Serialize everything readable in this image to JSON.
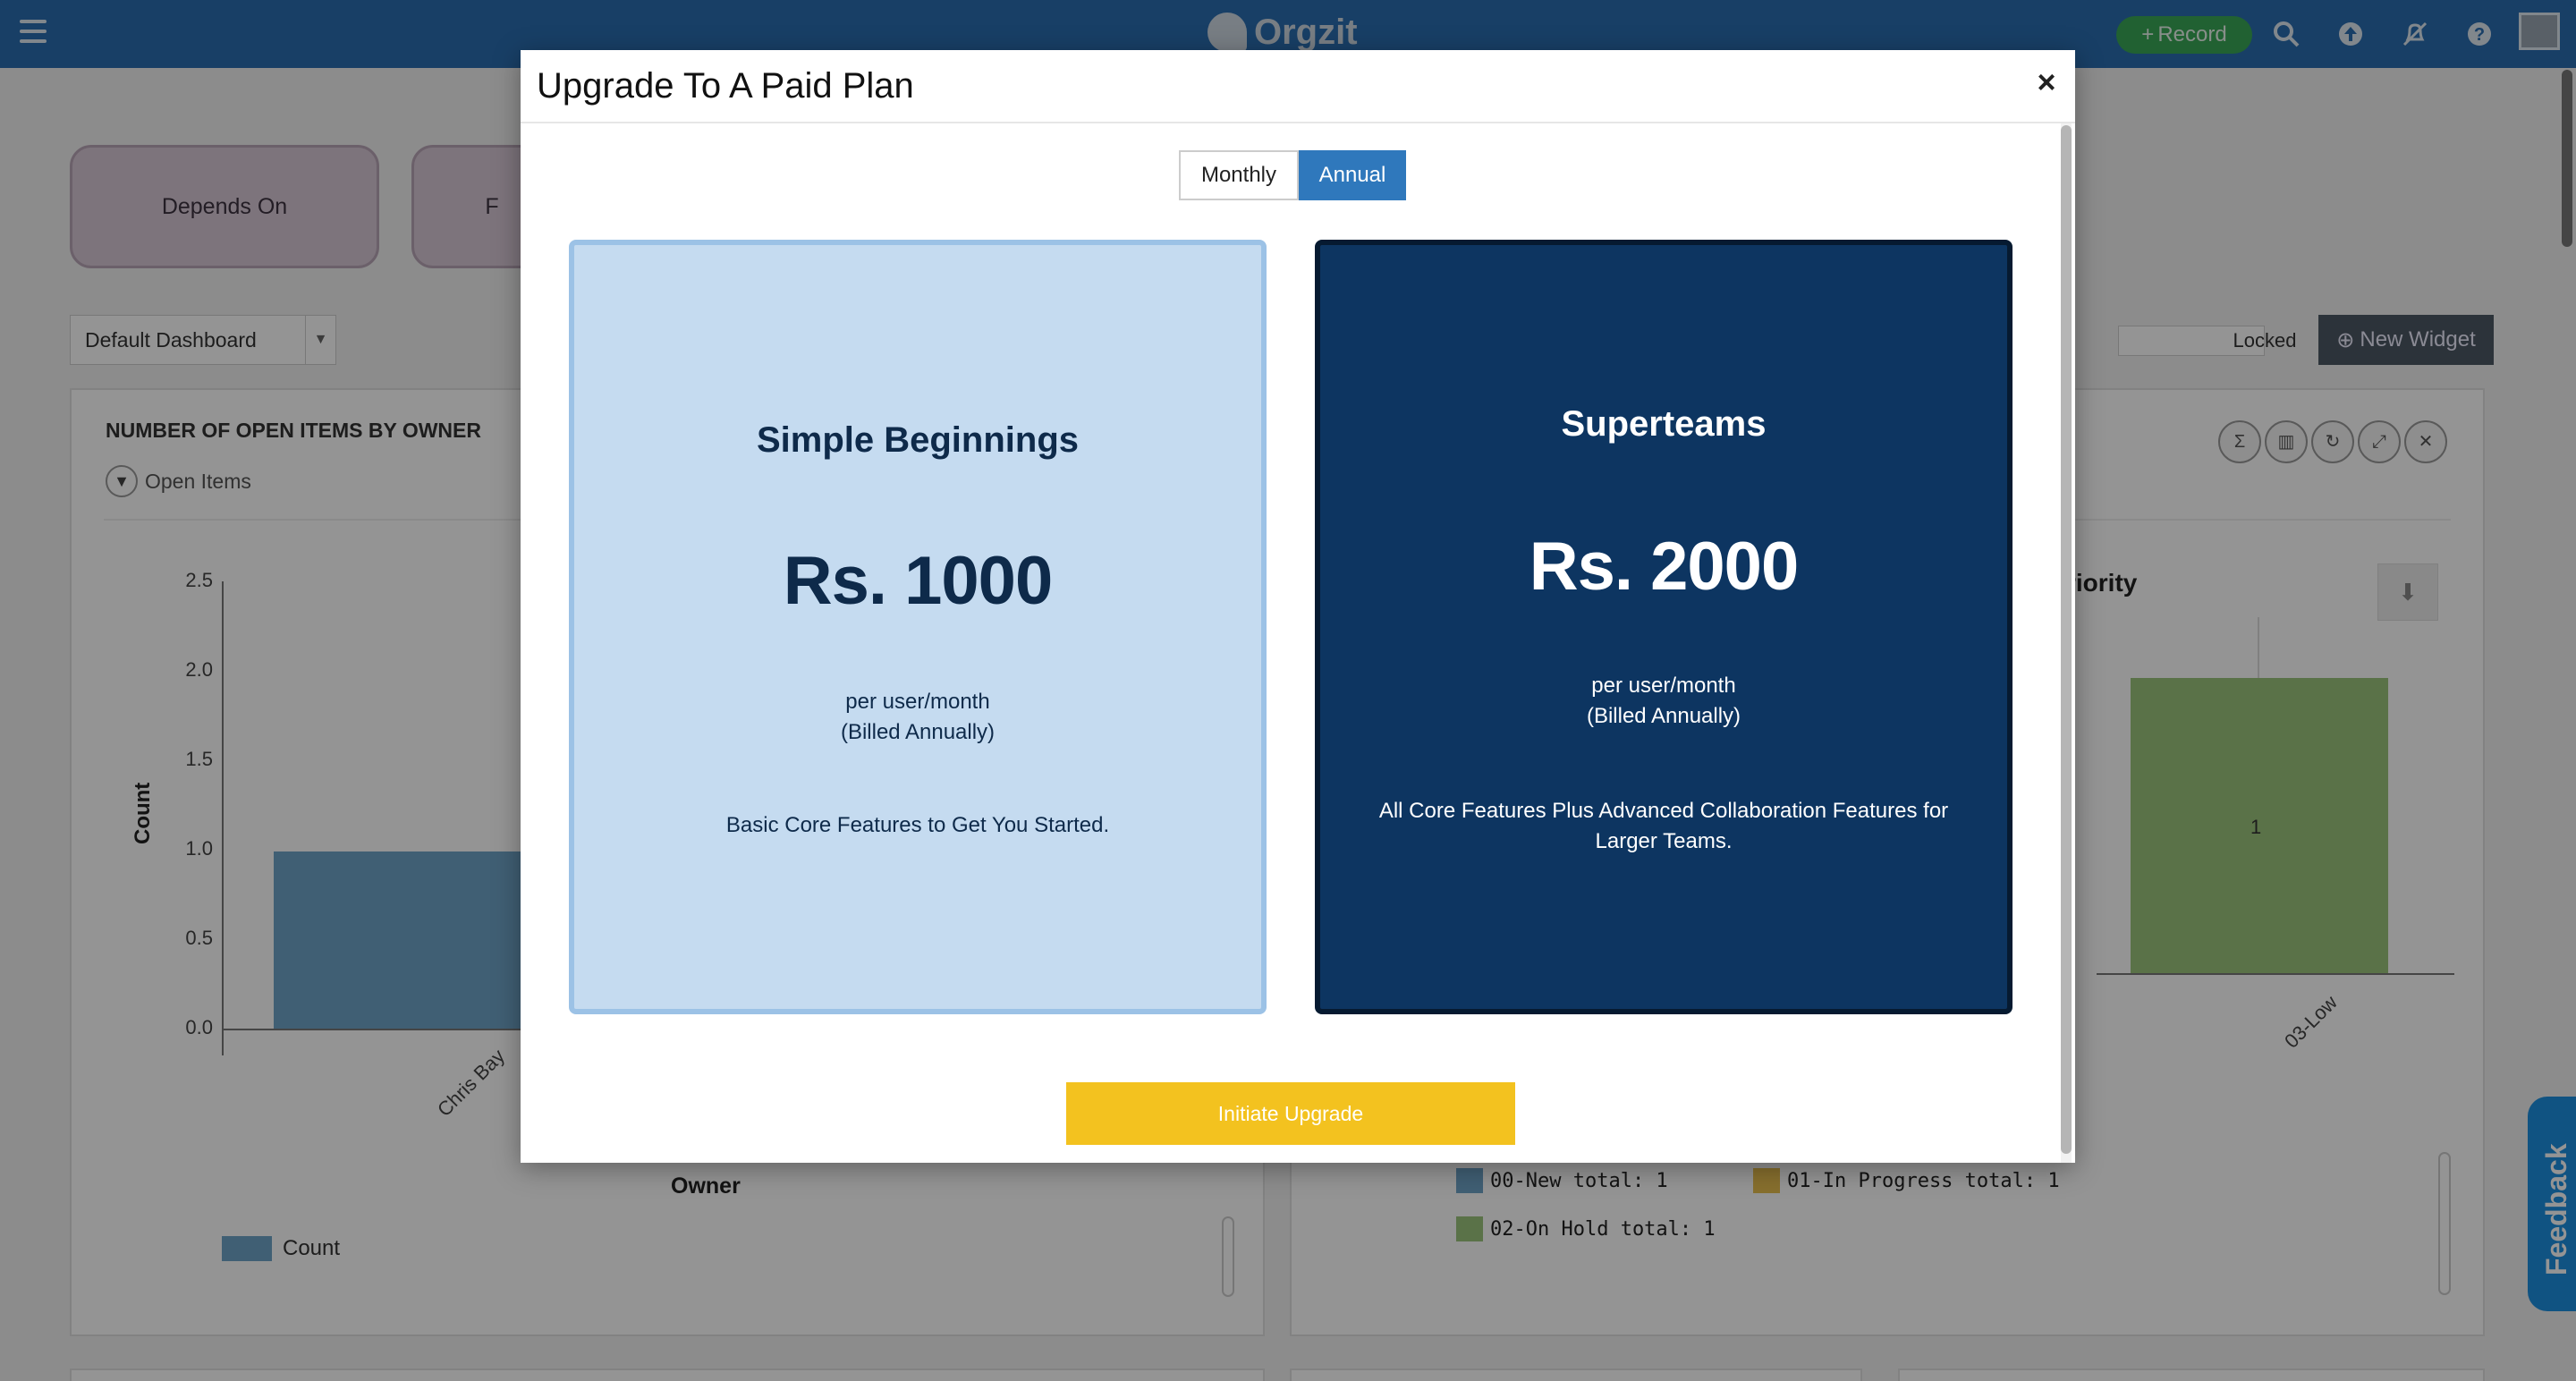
{
  "app": {
    "name": "Orgzit",
    "record_label": "Record",
    "icons": [
      "search-icon",
      "upload-icon",
      "notifications-off-icon",
      "help-icon"
    ],
    "tiles": [
      "Depends On",
      "F"
    ],
    "dashboard_select": "Default Dashboard",
    "locked_label": "Locked",
    "new_widget_label": "New Widget",
    "feedback_label": "Feedback"
  },
  "widget_left": {
    "title": "NUMBER OF OPEN ITEMS BY OWNER",
    "filter": "Open Items",
    "y_axis_title": "Count",
    "x_axis_title": "Owner",
    "y_ticks": [
      "2.5",
      "2.0",
      "1.5",
      "1.0",
      "0.5",
      "0.0"
    ],
    "x_labels": [
      "Chris Bay"
    ],
    "legend": "Count",
    "colors": {
      "bar": "#6fa4c8"
    }
  },
  "widget_right": {
    "title_partial": "riority",
    "bar_label": "1",
    "x_labels": [
      "03-Low"
    ],
    "legend": [
      {
        "label": "00-New total: 1",
        "color": "#6fa4c8"
      },
      {
        "label": "01-In Progress total: 1",
        "color": "#e8c050"
      },
      {
        "label": "02-On Hold total: 1",
        "color": "#9cc47c"
      }
    ],
    "tool_icons": [
      "sum-icon",
      "bar-chart-icon",
      "refresh-icon",
      "expand-icon",
      "close-icon"
    ],
    "download_icon": "download-icon",
    "colors": {
      "bar": "#9cc47c"
    }
  },
  "modal": {
    "title": "Upgrade To A Paid Plan",
    "close_label": "×",
    "billing_options": [
      "Monthly",
      "Annual"
    ],
    "selected_billing": "Annual",
    "plans": [
      {
        "name": "Simple Beginnings",
        "price": "Rs. 1000",
        "unit_line1": "per user/month",
        "unit_line2": "(Billed Annually)",
        "description": "Basic Core Features to Get You Started."
      },
      {
        "name": "Superteams",
        "price": "Rs. 2000",
        "unit_line1": "per user/month",
        "unit_line2": "(Billed Annually)",
        "description": "All Core Features Plus Advanced Collaboration Features for Larger Teams."
      }
    ],
    "cta_label": "Initiate Upgrade",
    "colors": {
      "accent": "#2f78bc",
      "cta": "#f3c21f",
      "basic_bg": "#c5dbf0",
      "team_bg": "#0d3561"
    }
  }
}
